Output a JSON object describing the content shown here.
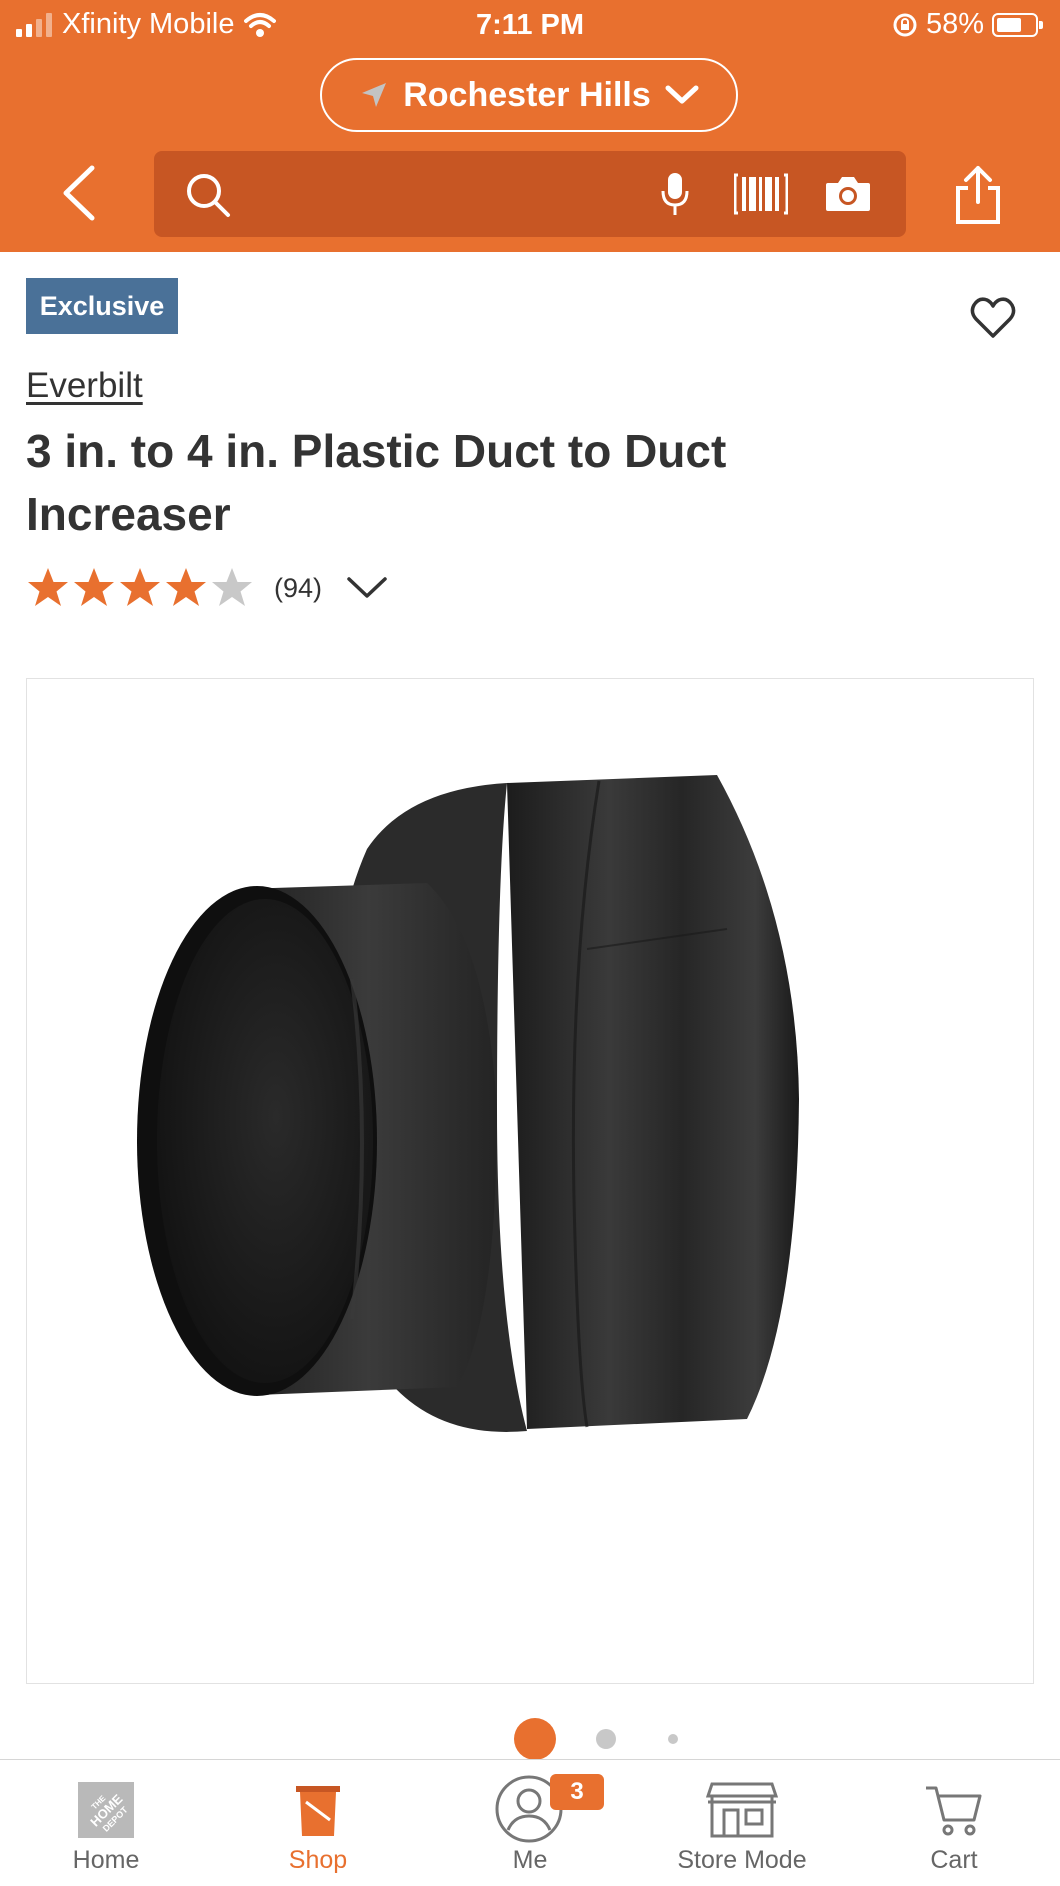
{
  "status_bar": {
    "carrier": "Xfinity Mobile",
    "time": "7:11 PM",
    "battery": "58%",
    "battery_level": 0.58
  },
  "header": {
    "location": "Rochester Hills",
    "search_placeholder": "",
    "accent_color": "#e8702f"
  },
  "product": {
    "badge": "Exclusive",
    "brand": "Everbilt",
    "title": "3 in. to 4 in. Plastic Duct to Duct Increaser",
    "rating": 4,
    "rating_max": 5,
    "review_count": "(94)",
    "image_count": 3,
    "active_image": 1
  },
  "tabbar": {
    "items": [
      {
        "label": "Home",
        "icon": "home-depot-logo-icon"
      },
      {
        "label": "Shop",
        "icon": "shop-bucket-icon"
      },
      {
        "label": "Me",
        "icon": "user-icon",
        "badge": "3"
      },
      {
        "label": "Store Mode",
        "icon": "store-icon"
      },
      {
        "label": "Cart",
        "icon": "cart-icon"
      }
    ],
    "active": "Shop"
  },
  "icons": {
    "back": "chevron-left-icon",
    "search": "search-icon",
    "mic": "microphone-icon",
    "barcode": "barcode-icon",
    "camera": "camera-icon",
    "share": "share-icon",
    "favorite": "heart-icon",
    "location": "location-arrow-icon"
  }
}
